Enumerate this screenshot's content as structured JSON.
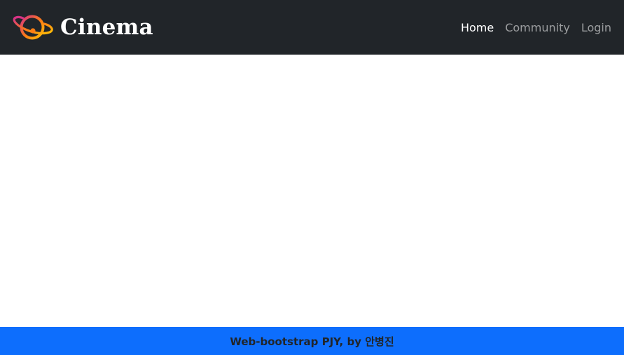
{
  "navbar": {
    "brand": {
      "logo_icon": "planet-orbit-icon",
      "text": "Cinema"
    },
    "links": [
      {
        "label": "Home",
        "active": true
      },
      {
        "label": "Community",
        "active": false
      },
      {
        "label": "Login",
        "active": false
      }
    ],
    "background": "#212529"
  },
  "footer": {
    "text": "Web-bootstrap PJY, by 안병진",
    "background": "#0d6efd"
  },
  "colors": {
    "logo_gradient_start": "#d63384",
    "logo_gradient_end": "#ffc107",
    "nav_active": "#ffffff",
    "nav_inactive": "rgba(255,255,255,0.55)"
  }
}
